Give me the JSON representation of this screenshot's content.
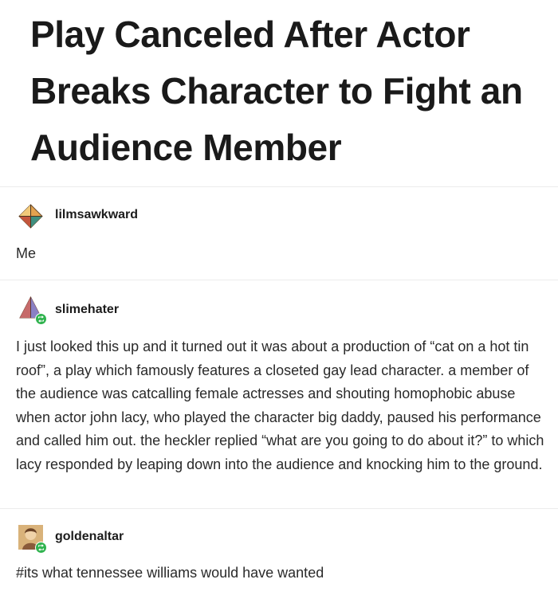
{
  "headline": "Play Canceled After Actor Breaks Character to Fight an Audience Member",
  "posts": [
    {
      "username": "lilmsawkward",
      "avatar_icon": "diamond-avatar-icon",
      "text": "Me"
    },
    {
      "username": "slimehater",
      "avatar_icon": "pyramid-avatar-icon",
      "text": "I just looked this up and it turned out it was about a production of “cat on a hot tin roof”, a play which famously features a closeted gay lead character. a member of the audience was catcalling female actresses and shouting homophobic abuse when actor john lacy, who played the character big daddy, paused his performance and called him out. the heckler replied “what are you going to do about it?” to which lacy responded by leaping down into the audience and knocking him to the ground."
    },
    {
      "username": "goldenaltar",
      "avatar_icon": "photo-avatar-icon",
      "text": "#its what tennessee williams would have wanted"
    }
  ],
  "colors": {
    "text": "#222222",
    "divider": "#ececec",
    "reblog_badge": "#2fb34e"
  }
}
